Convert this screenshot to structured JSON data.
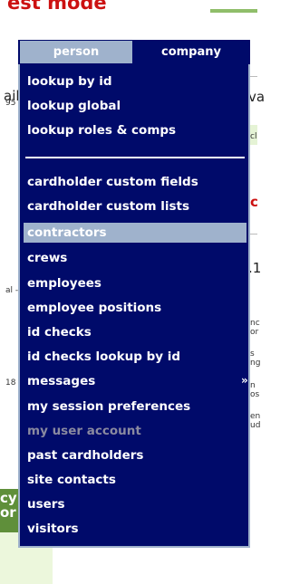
{
  "background": {
    "title": "est mode",
    "fragments_left": [
      "ail",
      "95",
      "al -",
      "18"
    ],
    "fragments_right": [
      "va",
      "cl",
      "c",
      ".1",
      "nc",
      "or",
      "s",
      "ng",
      "n",
      "os",
      "en",
      "ud"
    ],
    "green_block_text": "cy or"
  },
  "tabs": [
    {
      "label": "person",
      "active": true
    },
    {
      "label": "company",
      "active": false
    }
  ],
  "menu": {
    "group1": [
      "lookup by id",
      "lookup global",
      "lookup roles & comps"
    ],
    "group2": [
      {
        "label": "cardholder custom fields"
      },
      {
        "label": "cardholder custom lists"
      },
      {
        "label": "contractors",
        "selected": true
      },
      {
        "label": "crews"
      },
      {
        "label": "employees"
      },
      {
        "label": "employee positions"
      },
      {
        "label": "id checks"
      },
      {
        "label": "id checks lookup by id"
      },
      {
        "label": "messages",
        "submenu_arrow": "»"
      },
      {
        "label": "my session preferences"
      },
      {
        "label": "my user account",
        "disabled": true
      },
      {
        "label": "past cardholders"
      },
      {
        "label": "site contacts"
      },
      {
        "label": "users"
      },
      {
        "label": "visitors"
      }
    ]
  },
  "colors": {
    "menu_bg": "#000a6a",
    "tab_active_bg": "#9fb2cc",
    "selected_bg": "#9fb2cc",
    "text": "#ffffff",
    "disabled_text": "#8a8aa0",
    "title_red": "#cc1111"
  }
}
